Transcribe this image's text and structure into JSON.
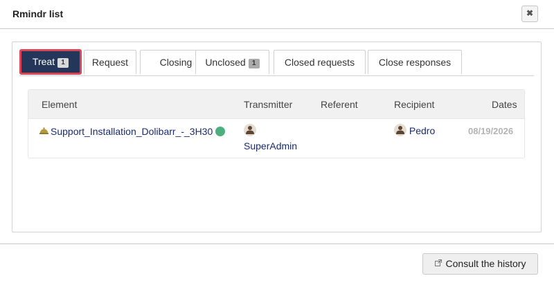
{
  "dialog": {
    "title": "Rmindr list",
    "close_glyph": "✖"
  },
  "tabs": [
    {
      "label": "Treat",
      "badge": "1",
      "active": true
    },
    {
      "label": "Request",
      "badge": null,
      "active": false
    },
    {
      "label": "Closing",
      "badge": null,
      "active": false
    },
    {
      "label": "Unclosed",
      "badge": "1",
      "active": false
    },
    {
      "label": "Closed requests",
      "badge": null,
      "active": false
    },
    {
      "label": "Close responses",
      "badge": null,
      "active": false
    }
  ],
  "table": {
    "headers": {
      "element": "Element",
      "transmitter": "Transmitter",
      "referent": "Referent",
      "recipient": "Recipient",
      "dates": "Dates"
    },
    "rows": [
      {
        "element": "Support_Installation_Dolibarr_-_3H30",
        "element_icon": "bell-icon",
        "status_color": "#4caf7d",
        "transmitter": "SuperAdmin",
        "referent": "",
        "recipient": "Pedro",
        "date": "08/19/2026"
      }
    ]
  },
  "footer": {
    "history_label": "Consult the history",
    "history_icon": "external-link-icon"
  },
  "colors": {
    "active_tab_bg": "#24375a",
    "active_tab_border": "#e04555",
    "link": "#1a2a6e",
    "status_dot": "#4caf7d"
  }
}
